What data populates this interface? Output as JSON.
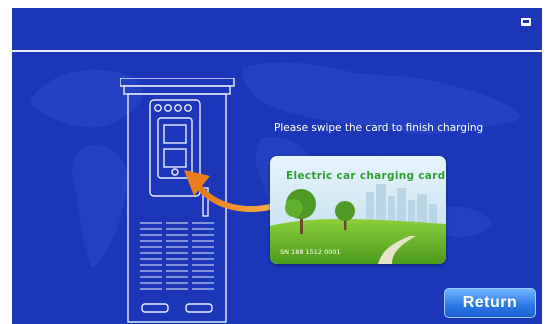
{
  "screen": {
    "instruction": "Please swipe the card to finish charging",
    "card": {
      "title": "Electric car charging card",
      "serial": "SN 188   1512 0001"
    },
    "return_label": "Return",
    "status_icon": "hand-cursor-icon"
  },
  "colors": {
    "background": "#1b36b8",
    "line": "#e9eef8",
    "card_title": "#2f9e35",
    "arrow": "#f08a24",
    "button": "#2b77e6"
  }
}
